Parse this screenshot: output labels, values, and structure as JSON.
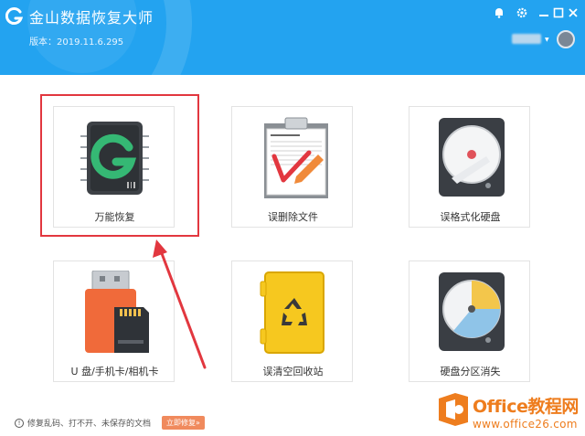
{
  "app": {
    "title": "金山数据恢复大师",
    "version": "版本：2019.11.6.295"
  },
  "colors": {
    "header": "#23a3f0",
    "highlight": "#e2373f",
    "repair": "#f08a5d",
    "watermark": "#ee7d1e"
  },
  "header": {
    "icons": [
      "bell-icon",
      "gear-icon",
      "minimize-icon",
      "maximize-icon",
      "close-icon",
      "chevron-down-icon"
    ]
  },
  "cards": [
    {
      "label": "万能恢复",
      "icon": "chip-g-icon"
    },
    {
      "label": "误删除文件",
      "icon": "clipboard-icon"
    },
    {
      "label": "误格式化硬盘",
      "icon": "hard-disk-icon"
    },
    {
      "label": "U 盘/手机卡/相机卡",
      "icon": "usb-sdcard-icon"
    },
    {
      "label": "误清空回收站",
      "icon": "recycle-bin-icon"
    },
    {
      "label": "硬盘分区消失",
      "icon": "partition-disk-icon"
    }
  ],
  "footer": {
    "info_icon": "!",
    "text": "修复乱码、打不开、未保存的文档",
    "repair_button": "立即修复»"
  },
  "watermark": {
    "name": "Office教程网",
    "url": "www.office26.com"
  }
}
